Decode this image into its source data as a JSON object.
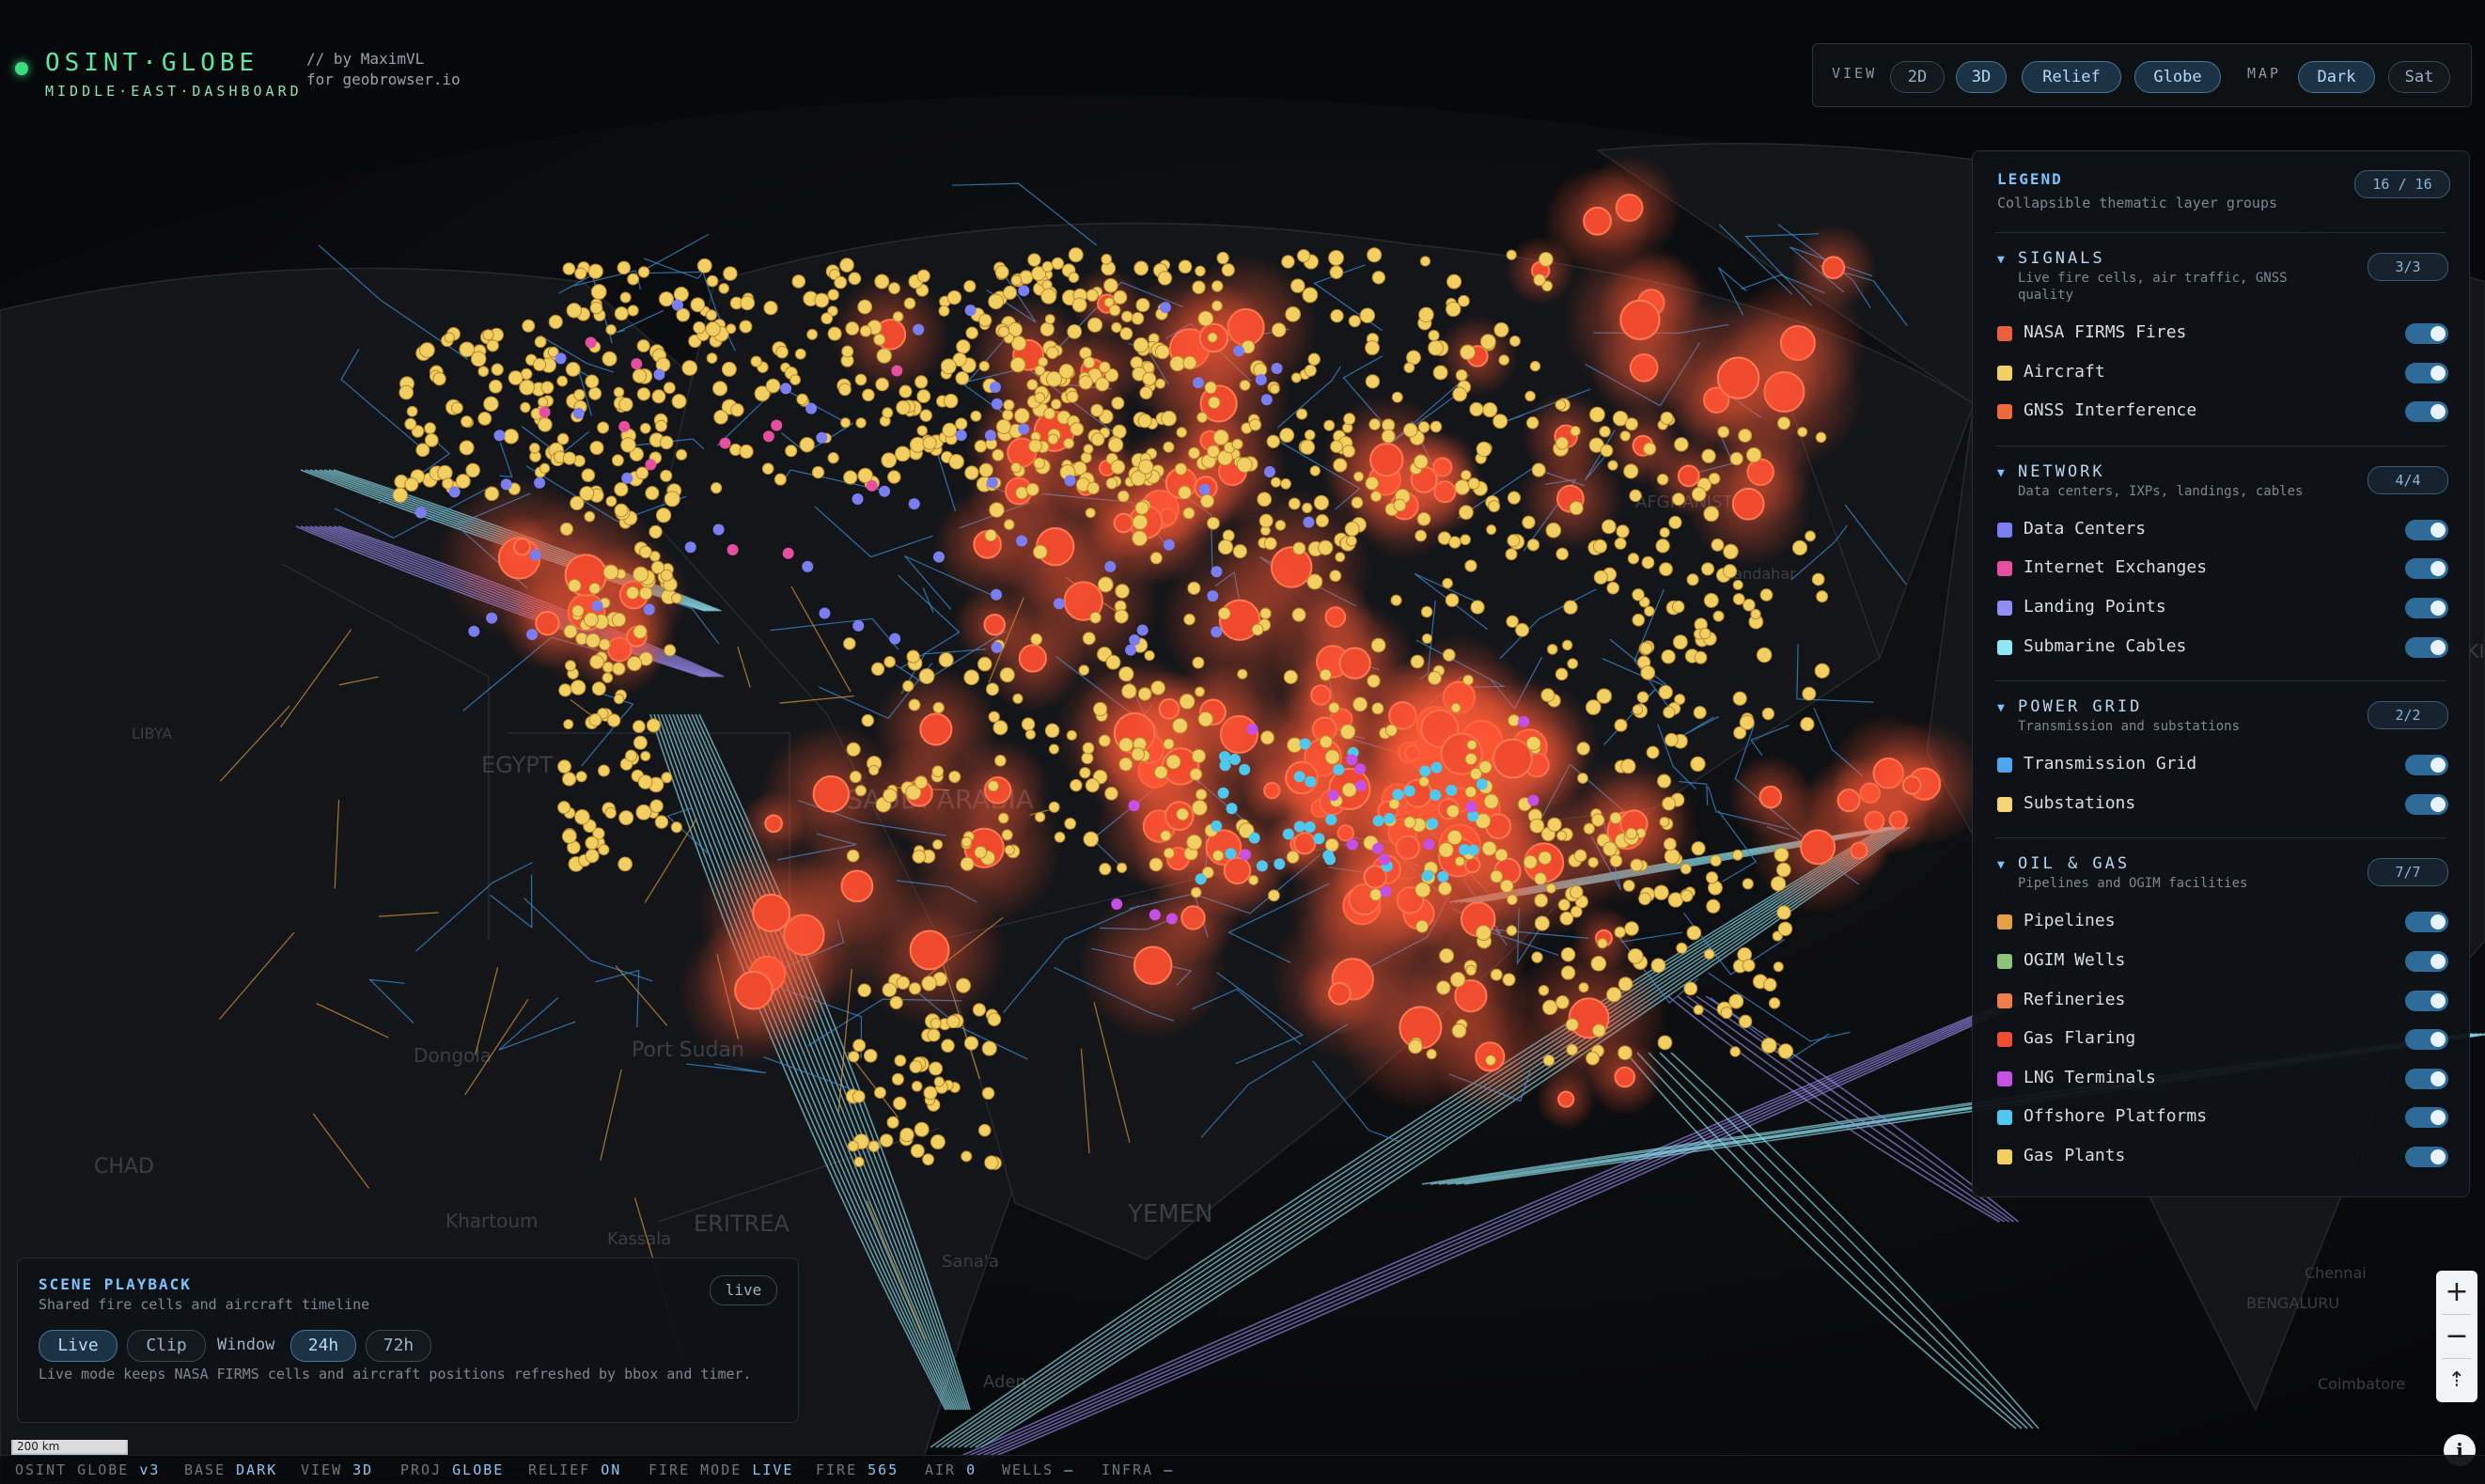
{
  "brand": {
    "title": "OSINT·GLOBE",
    "subtitle": "MIDDLE·EAST·DASHBOARD",
    "byline": "// by MaximVL\nfor geobrowser.io"
  },
  "toolbar": {
    "view_label": "VIEW",
    "view_buttons": [
      "2D",
      "3D",
      "Relief",
      "Globe"
    ],
    "view_active": [
      "3D",
      "Relief",
      "Globe"
    ],
    "map_label": "MAP",
    "map_buttons": [
      "Dark",
      "Sat"
    ],
    "map_active": "Dark"
  },
  "legend": {
    "title": "LEGEND",
    "subtitle": "Collapsible thematic layer groups",
    "count": "16 / 16",
    "groups": [
      {
        "title": "SIGNALS",
        "subtitle": "Live fire cells, air traffic, GNSS quality",
        "count": "3/3",
        "items": [
          {
            "label": "NASA FIRMS Fires",
            "color": "#e8603c",
            "on": true
          },
          {
            "label": "Aircraft",
            "color": "#f2cf63",
            "on": true
          },
          {
            "label": "GNSS Interference",
            "color": "#ee6a3a",
            "on": true
          }
        ]
      },
      {
        "title": "NETWORK",
        "subtitle": "Data centers, IXPs, landings, cables",
        "count": "4/4",
        "items": [
          {
            "label": "Data Centers",
            "color": "#7b7ef0",
            "on": true
          },
          {
            "label": "Internet Exchanges",
            "color": "#e64fa0",
            "on": true
          },
          {
            "label": "Landing Points",
            "color": "#8f8ef2",
            "on": true
          },
          {
            "label": "Submarine Cables",
            "color": "#8fe6f4",
            "on": true
          }
        ]
      },
      {
        "title": "POWER GRID",
        "subtitle": "Transmission and substations",
        "count": "2/2",
        "items": [
          {
            "label": "Transmission Grid",
            "color": "#4fa6ee",
            "on": true
          },
          {
            "label": "Substations",
            "color": "#f4d774",
            "on": true
          }
        ]
      },
      {
        "title": "OIL & GAS",
        "subtitle": "Pipelines and OGIM facilities",
        "count": "7/7",
        "items": [
          {
            "label": "Pipelines",
            "color": "#e2a043",
            "on": true
          },
          {
            "label": "OGIM Wells",
            "color": "#8fc27a",
            "on": true
          },
          {
            "label": "Refineries",
            "color": "#ef7d49",
            "on": true
          },
          {
            "label": "Gas Flaring",
            "color": "#ee4d34",
            "on": true
          },
          {
            "label": "LNG Terminals",
            "color": "#c64fe4",
            "on": true
          },
          {
            "label": "Offshore Platforms",
            "color": "#4fc8ee",
            "on": true
          },
          {
            "label": "Gas Plants",
            "color": "#f2d060",
            "on": true
          }
        ]
      }
    ]
  },
  "playback": {
    "title": "SCENE PLAYBACK",
    "subtitle": "Shared fire cells and aircraft timeline",
    "live_badge": "live",
    "buttons": [
      "Live",
      "Clip"
    ],
    "active_mode": "Live",
    "window_label": "Window",
    "windows": [
      "24h",
      "72h"
    ],
    "active_window": "24h",
    "note": "Live mode keeps NASA FIRMS cells and aircraft positions refreshed by bbox and timer."
  },
  "map_labels": [
    "EGYPT",
    "SAUDI ARABIA",
    "YEMEN",
    "ERITREA",
    "CHAD",
    "AFGHANISTAN",
    "LIBYA",
    "Port Sudan",
    "Dongola",
    "Khartoum",
    "Kassala",
    "Aden",
    "Sana'a",
    "Kandahar",
    "BENGALURU",
    "Chennai",
    "Coimbatore",
    "PAKI"
  ],
  "scale_label": "200 km",
  "status": [
    {
      "k": "OSINT GLOBE",
      "v": "v3"
    },
    {
      "k": "BASE",
      "v": "DARK"
    },
    {
      "k": "VIEW",
      "v": "3D"
    },
    {
      "k": "PROJ",
      "v": "GLOBE"
    },
    {
      "k": "RELIEF",
      "v": "ON"
    },
    {
      "k": "FIRE MODE",
      "v": "LIVE"
    },
    {
      "k": "FIRE",
      "v": "565"
    },
    {
      "k": "AIR",
      "v": "0"
    },
    {
      "k": "WELLS",
      "v": "—"
    },
    {
      "k": "INFRA",
      "v": "—"
    }
  ]
}
